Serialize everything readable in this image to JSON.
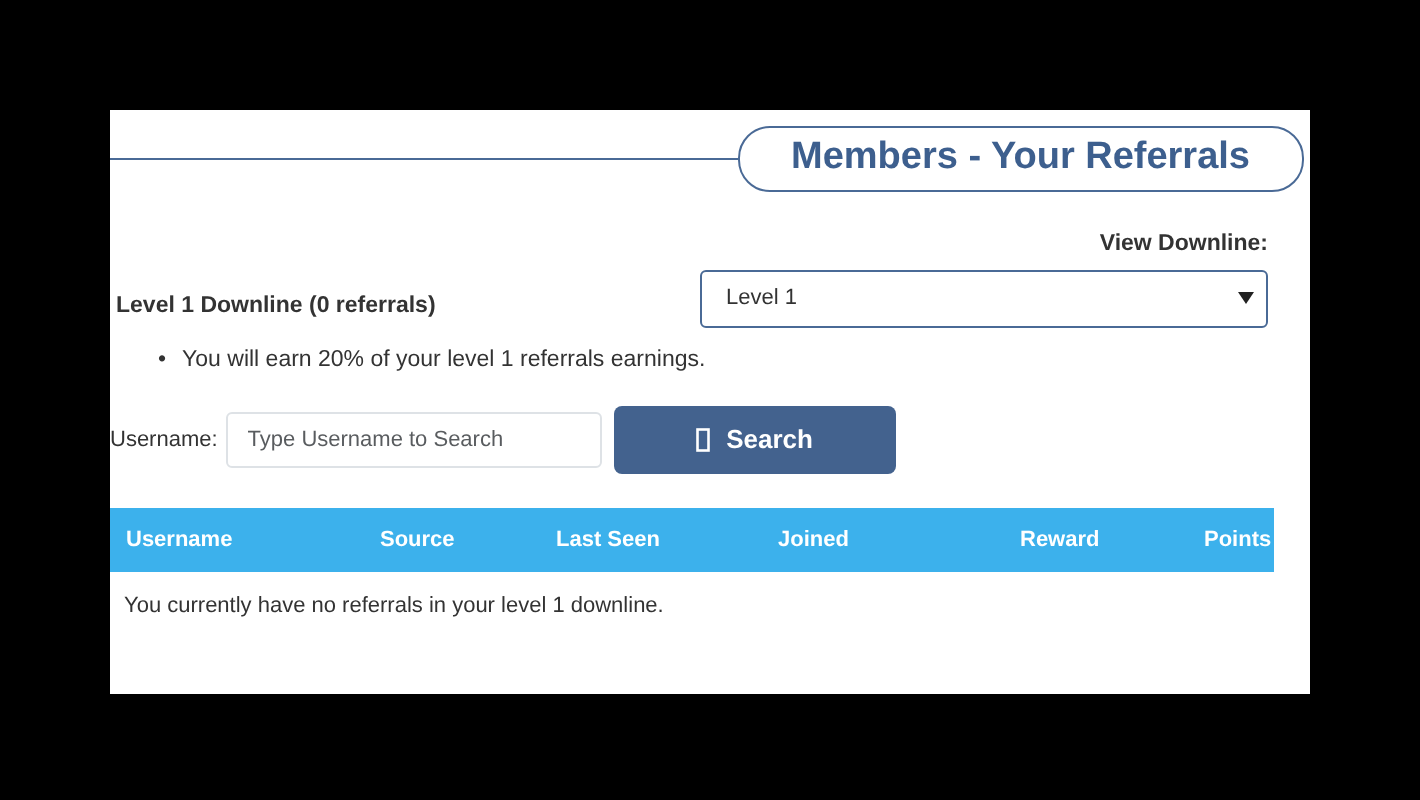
{
  "title": "Members - Your Referrals",
  "downline": {
    "label": "View Downline:",
    "value": "Level 1"
  },
  "heading": "Level 1 Downline (0 referrals)",
  "notes": [
    {
      "bullet": "•",
      "text": "You will earn 20% of your level 1 referrals earnings."
    }
  ],
  "search": {
    "label": "Username:",
    "placeholder": "Type Username to Search",
    "button": "Search"
  },
  "table": {
    "columns": [
      "Username",
      "Source",
      "Last Seen",
      "Joined",
      "Reward",
      "Points"
    ],
    "empty": "You currently have no referrals in your level 1 downline."
  }
}
